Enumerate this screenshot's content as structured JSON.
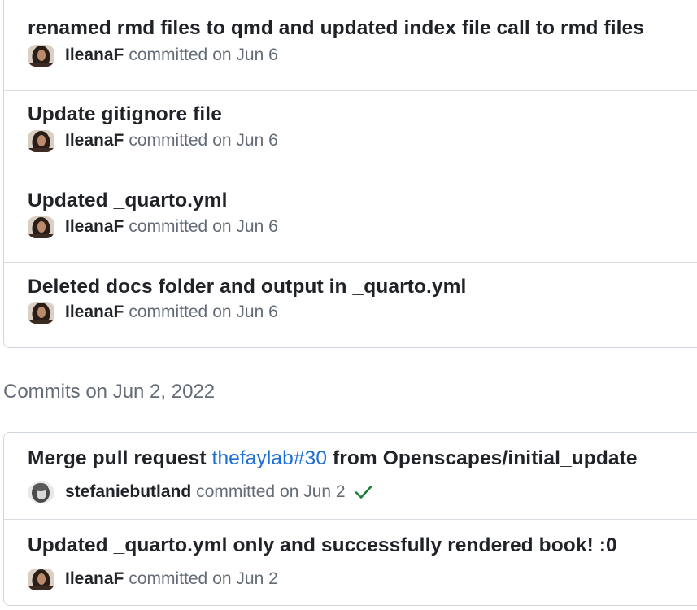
{
  "groups": [
    {
      "commits": [
        {
          "title": "renamed rmd files to qmd and updated index file call to rmd files",
          "author": "IleanaF",
          "action": "committed",
          "date": "on Jun 6"
        },
        {
          "title": "Update gitignore file",
          "author": "IleanaF",
          "action": "committed",
          "date": "on Jun 6"
        },
        {
          "title": "Updated _quarto.yml",
          "author": "IleanaF",
          "action": "committed",
          "date": "on Jun 6"
        },
        {
          "title": "Deleted docs folder and output in _quarto.yml",
          "author": "IleanaF",
          "action": "committed",
          "date": "on Jun 6"
        }
      ]
    },
    {
      "header": "Commits on Jun 2, 2022",
      "commits": [
        {
          "title_prefix": "Merge pull request ",
          "title_link": "thefaylab#30",
          "title_suffix": " from Openscapes/initial_update",
          "author": "stefaniebutland",
          "action": "committed",
          "date": "on Jun 2",
          "status_icon": "check-icon"
        },
        {
          "title": "Updated _quarto.yml only and successfully rendered book! :0",
          "author": "IleanaF",
          "action": "committed",
          "date": "on Jun 2"
        }
      ]
    }
  ],
  "colors": {
    "link": "#1b6ed6",
    "check": "#1a7f37",
    "muted": "#636c76",
    "border": "#d0d7de"
  }
}
